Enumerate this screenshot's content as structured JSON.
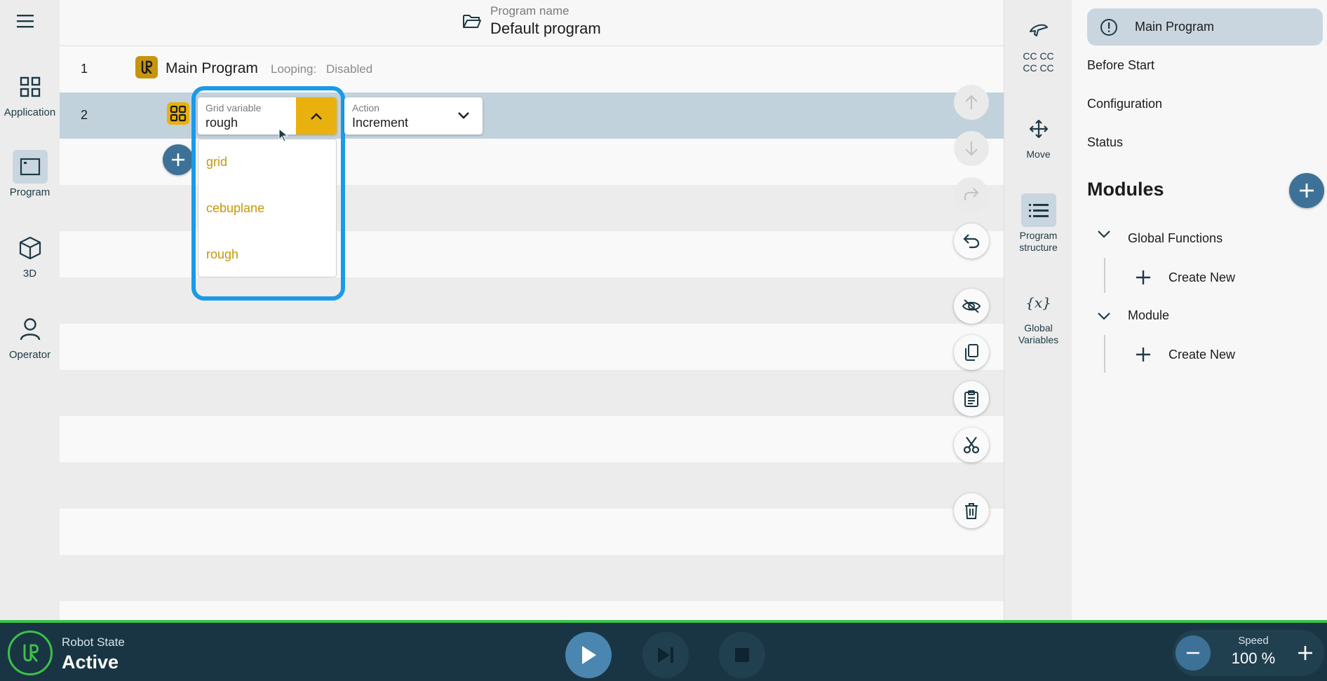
{
  "nav": {
    "items": [
      {
        "label": "Application",
        "icon": "grid-icon"
      },
      {
        "label": "Program",
        "icon": "window-icon"
      },
      {
        "label": "3D",
        "icon": "cube-icon"
      },
      {
        "label": "Operator",
        "icon": "person-icon"
      }
    ],
    "active": "Program"
  },
  "header": {
    "program_name_label": "Program name",
    "program_name_value": "Default program"
  },
  "program": {
    "rows": [
      {
        "number": "1",
        "title": "Main Program",
        "looping_label": "Looping:",
        "looping_value": "Disabled"
      },
      {
        "number": "2"
      }
    ],
    "grid_variable": {
      "label": "Grid variable",
      "value": "rough",
      "options": [
        "grid",
        "cebuplane",
        "rough"
      ]
    },
    "action": {
      "label": "Action",
      "value": "Increment"
    }
  },
  "tools": {
    "items": [
      {
        "label": "CC CC\nCC CC",
        "line1": "CC CC",
        "line2": "CC CC",
        "icon": "gripper-icon"
      },
      {
        "label": "Move",
        "icon": "move-icon"
      },
      {
        "label": "Program structure",
        "line1": "Program",
        "line2": "structure",
        "icon": "list-icon"
      },
      {
        "label": "Global Variables",
        "line1": "Global",
        "line2": "Variables",
        "icon": "variable-icon"
      }
    ]
  },
  "structure": {
    "items": [
      "Main Program",
      "Before Start",
      "Configuration",
      "Status"
    ],
    "modules_title": "Modules",
    "groups": [
      {
        "name": "Global Functions",
        "create": "Create New"
      },
      {
        "name": "Module",
        "create": "Create New"
      }
    ]
  },
  "bottom": {
    "robot_state_label": "Robot State",
    "robot_state_value": "Active",
    "speed_label": "Speed",
    "speed_value": "100 %"
  },
  "colors": {
    "accent_yellow": "#e8b10d",
    "option_text": "#c9960a",
    "highlight_row": "#c2d2dd",
    "focus_outline": "#1a9ae8",
    "bottom_bar": "#193543",
    "status_green": "#3bc14a",
    "play_blue": "#4a86b0",
    "add_blue": "#3d7197"
  }
}
